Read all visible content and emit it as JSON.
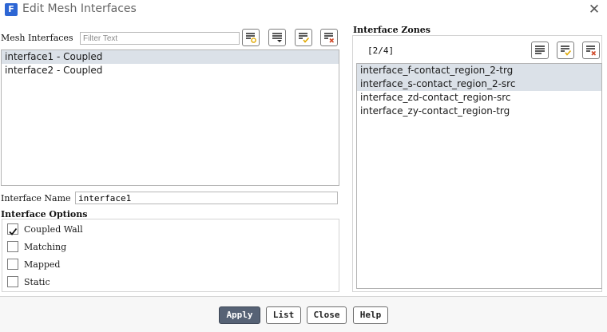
{
  "window": {
    "title": "Edit Mesh Interfaces",
    "app_icon_letter": "F",
    "close_glyph": "✕"
  },
  "mesh_interfaces": {
    "label": "Mesh Interfaces",
    "filter_placeholder": "Filter Text",
    "items": [
      {
        "label": "interface1 - Coupled",
        "selected": true
      },
      {
        "label": "interface2 - Coupled",
        "selected": false
      }
    ]
  },
  "interface_name": {
    "label": "Interface Name",
    "value": "interface1"
  },
  "interface_options": {
    "label": "Interface Options",
    "options": [
      {
        "label": "Coupled Wall",
        "checked": true
      },
      {
        "label": "Matching",
        "checked": false
      },
      {
        "label": "Mapped",
        "checked": false
      },
      {
        "label": "Static",
        "checked": false
      }
    ]
  },
  "interface_zones": {
    "label": "Interface Zones",
    "count": "[2/4]",
    "items": [
      {
        "label": "interface_f-contact_region_2-trg",
        "selected": true
      },
      {
        "label": "interface_s-contact_region_2-src",
        "selected": true
      },
      {
        "label": "interface_zd-contact_region-src",
        "selected": false
      },
      {
        "label": "interface_zy-contact_region-trg",
        "selected": false
      }
    ]
  },
  "buttons": {
    "apply": "Apply",
    "list": "List",
    "close": "Close",
    "help": "Help"
  },
  "colors": {
    "accent": "#566275",
    "selection": "#dbe1e8",
    "check_accent": "#e0a800",
    "deselect_accent": "#d04a2a"
  }
}
